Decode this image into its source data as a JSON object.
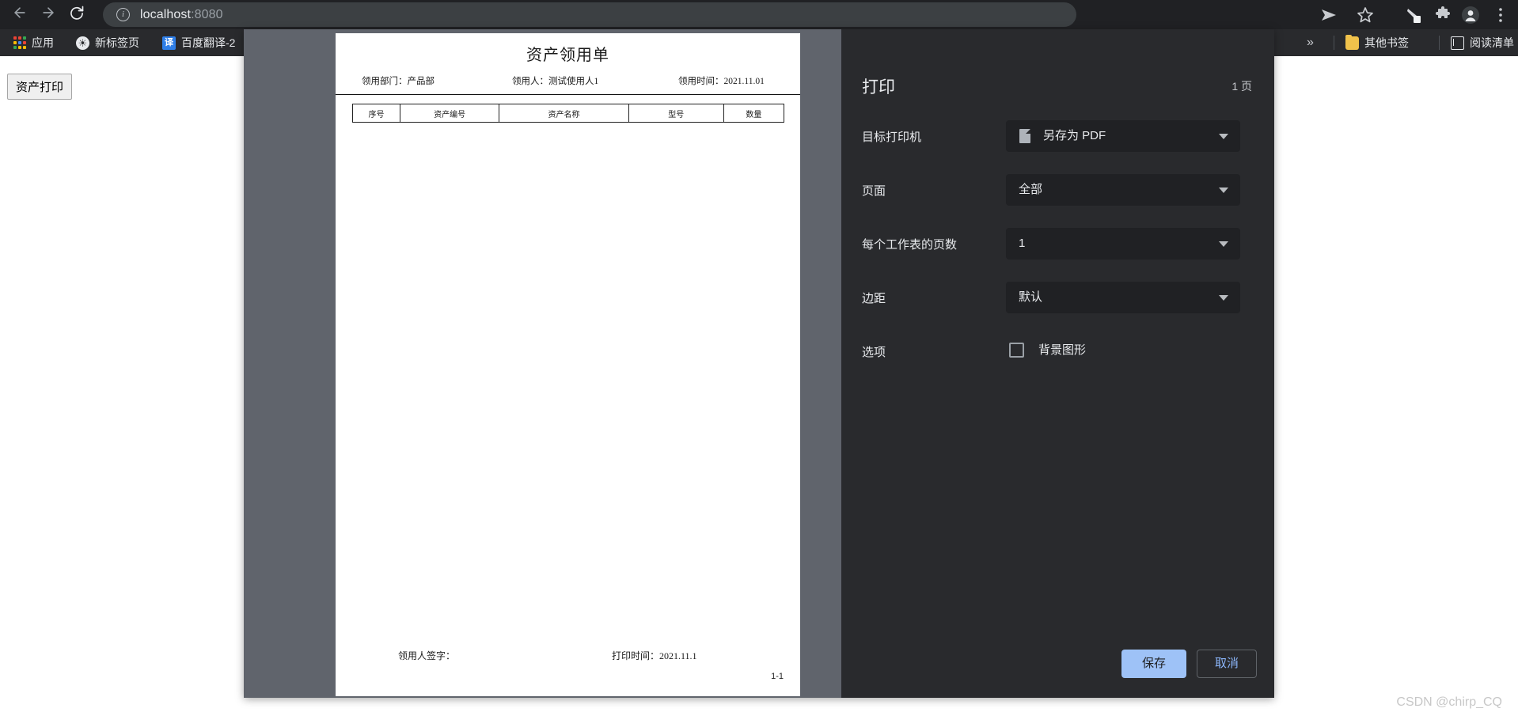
{
  "browser": {
    "back_icon": "back-arrow-icon",
    "forward_icon": "forward-arrow-icon",
    "reload_icon": "reload-icon",
    "site_info_icon": "info-icon",
    "url_host": "localhost",
    "url_port": ":8080",
    "toolbar_icons": [
      "share-icon",
      "star-icon",
      "pen-icon",
      "extensions-icon",
      "profile-icon",
      "menu-icon"
    ],
    "bookmarks": [
      {
        "label": "应用",
        "icon": "apps-grid-icon"
      },
      {
        "label": "新标签页",
        "icon": "globe-icon"
      },
      {
        "label": "百度翻译-2",
        "icon": "translate-icon"
      }
    ],
    "overflow_label": "»",
    "other_bookmarks": {
      "label": "其他书签",
      "icon": "folder-icon"
    },
    "reading_list": {
      "label": "阅读清单",
      "icon": "reading-list-icon"
    }
  },
  "page": {
    "asset_print_button": "资产打印"
  },
  "preview": {
    "title": "资产领用单",
    "meta": {
      "dept": "领用部门：产品部",
      "person": "领用人：测试使用人1",
      "time": "领用时间：2021.11.01"
    },
    "table": {
      "columns": [
        "序号",
        "资产编号",
        "资产名称",
        "型号",
        "数量"
      ],
      "rows": []
    },
    "footer": {
      "signature": "领用人签字：",
      "print_time": "打印时间：2021.11.1"
    },
    "page_indicator": "1-1"
  },
  "print_dialog": {
    "title": "打印",
    "page_count": "1 页",
    "settings": [
      {
        "label": "目标打印机",
        "value": "另存为 PDF",
        "icon": "pdf-file-icon",
        "caret": "chevron-down-icon"
      },
      {
        "label": "页面",
        "value": "全部",
        "caret": "chevron-down-icon"
      },
      {
        "label": "每个工作表的页数",
        "value": "1",
        "caret": "chevron-down-icon"
      },
      {
        "label": "边距",
        "value": "默认",
        "caret": "chevron-down-icon"
      }
    ],
    "options": {
      "label": "选项",
      "background_graphics_label": "背景图形",
      "background_graphics_checked": false
    },
    "save_label": "保存",
    "cancel_label": "取消",
    "accent_color": "#9ec2f7",
    "link_color": "#8ab4f8",
    "panel_bg": "#292a2d",
    "control_bg": "#202124"
  },
  "watermark": "CSDN @chirp_CQ"
}
